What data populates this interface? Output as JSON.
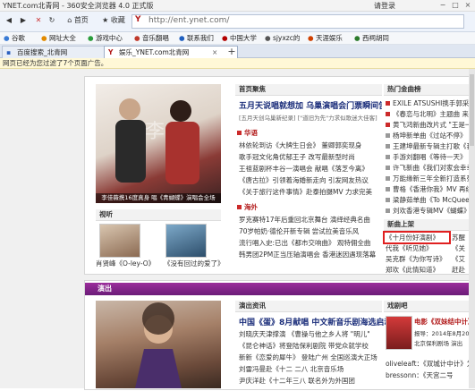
{
  "browser": {
    "title": "YNET.com北青网 - 360安全浏览器 4.0 正式版",
    "login": "请登录",
    "controls": [
      "−",
      "□",
      "×"
    ],
    "nav": {
      "back": "◀",
      "forward": "▶",
      "stop": "✕",
      "refresh": "↻",
      "home": "⌂",
      "bookmark_label": "收藏",
      "home_label": "首页"
    },
    "url": "http://ent.ynet.com/",
    "favorites": [
      "谷歌",
      "网址大全",
      "游戏中心",
      "音乐翻唱",
      "联系我们",
      "中国大学",
      "sjyxzc的",
      "天涯娱乐",
      "西祠胡同"
    ],
    "tabs": [
      {
        "label": "百度搜索_北青网"
      },
      {
        "label": "娱乐_YNET.com北青网"
      }
    ],
    "notice": "网页已经为您过滤了7个页面广告。"
  },
  "page": {
    "top_news": {
      "header": "首页聚焦",
      "headline": "五月天说唱就想加 乌巢演唱会门票瞬间告罄",
      "sub": "[五月天创乌巢新纪录] [\"道旧为先\"力求似歌迷大佳客]",
      "photo_caption": "李佳薇携16度真身 唱《青蝴蝶》演唱会全场",
      "section1_title": "华语",
      "section1": [
        "林依轮到访《大牌生日会》 董卿郭奕现身",
        "歌手冠文化角优郁王子 改写最新型时尚",
        "王祖蓝剧杯丰谷一演唱会 献唱《落芝今离》",
        "《唐古拉》引领着海婚新走向 引发网友热议",
        "《关于旅行这件事情》赴泰拍摄MV 力求完美"
      ],
      "section2_title": "海外",
      "section2": [
        "罗克赛特17年后重回北京舞台 演绎经典名曲",
        "70岁帕奶·德伦开新专辑 尝试拉美音乐风",
        "流行唱入史:已出《都市交响曲》 观特佣全曲",
        "韩男团2PM正当压轴演唱会 香港迷因遇现落幕"
      ],
      "video_header": "视听",
      "thumbs": [
        {
          "caption": "肖贤峰《O-ley-O》"
        },
        {
          "caption": "《没有回过的爱了》"
        }
      ]
    },
    "right_col": {
      "hot_header": "热门金曲榜",
      "hot_list": [
        "EXILE ATSUSHI携手郭采洁献唱",
        "《春恋与北明》主题曲 来北京演",
        "黄飞鸿新曲改片式 \"王是一年春未易",
        "杨坤新单曲《过站不停》 真爱入",
        "王建坤最新专辑主打歌《我的生",
        "手游刘翻唱《等待一天》 恋爱",
        "许飞新曲《我们对家会幸幸好学",
        "万能缘新三年全新打造系列曲",
        "曹格《香港你我》MV 再续捕获",
        "梁静茹单曲《To McQueen》 东",
        "刘欢香港专辑MV《蝴蝶》 MV 赚入"
      ],
      "new_header": "新曲上架",
      "new_list": [
        {
          "left": "《十月份好演剧》",
          "right": "苏醒"
        },
        {
          "left": "代我《听见她》",
          "right": "《关"
        },
        {
          "left": "吴克群《为你写诗》",
          "right": "《艾"
        },
        {
          "left": "郑欢《此情知道》",
          "right": "赶赴"
        },
        {
          "left": "《愁爱你越陈越我》",
          "right": "郑中"
        }
      ]
    },
    "perf": {
      "band_label": "演出",
      "col1_header": "演出资讯",
      "headline": "中国《蛋》8月献唱 中文新音乐剧海选启动",
      "items": [
        "刘晓庆天津撑演 《曹操与他之乡人将 \"明儿\"",
        "《昆仑神话》将登陆保利剧院 带党众就学校",
        "新新《恋爱的犀牛》 登陆广州 全国巡演大正场",
        "刘雷冯曼赴《十二 二八 北京音乐场",
        "尹庆洋赴《十二年三八 联名外为外国团"
      ],
      "col2_header": "戏剧吧",
      "col2_title": "电影《双妹结中计》",
      "col2_lines": [
        "报导：2014年8月20",
        "北京保利剧场 演出"
      ],
      "col2_bottom": [
        "oliveleaft：《双城计中计》为一部",
        "bressonn：《天宫二号"
      ]
    }
  }
}
